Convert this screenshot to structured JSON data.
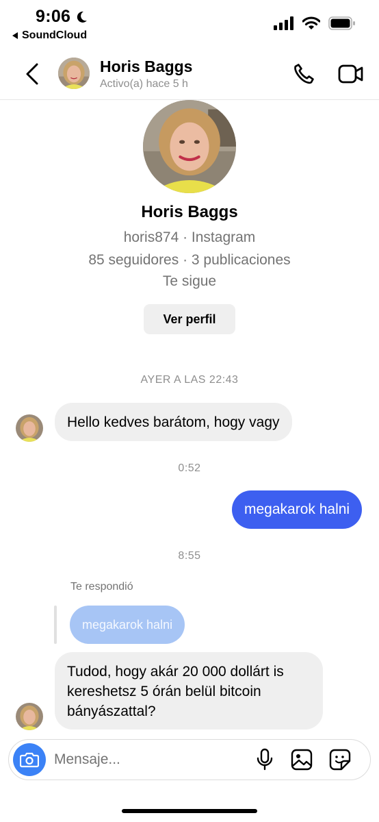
{
  "status_bar": {
    "time": "9:06",
    "back_app": "SoundCloud"
  },
  "header": {
    "name": "Horis Baggs",
    "status": "Activo(a) hace 5 h"
  },
  "profile": {
    "name": "Horis Baggs",
    "handle_line": "horis874 · Instagram",
    "stats_line": "85 seguidores · 3 publicaciones",
    "follow_status": "Te sigue",
    "view_profile_label": "Ver perfil"
  },
  "messages": {
    "timestamp_1": "AYER A LAS 22:43",
    "msg_1": "Hello kedves barátom, hogy vagy",
    "timestamp_2": "0:52",
    "msg_2": "megakarok halni",
    "timestamp_3": "8:55",
    "reply_label": "Te respondió",
    "reply_quote": "megakarok halni",
    "msg_3_lines": [
      "Tudod, hogy akár 20 000 dollárt is",
      "kereshetsz 5 órán belül bitcoin",
      "bányászattal?"
    ]
  },
  "composer": {
    "placeholder": "Mensaje..."
  },
  "colors": {
    "outgoing_bubble": "#3d5ff0",
    "incoming_bubble": "#efefef",
    "camera_button": "#3b82f6",
    "reply_quote": "#a7c5f5"
  },
  "icons": [
    "moon-icon",
    "signal-icon",
    "wifi-icon",
    "battery-icon",
    "back-arrow-icon",
    "phone-icon",
    "video-icon",
    "camera-icon",
    "microphone-icon",
    "image-icon",
    "sticker-icon"
  ]
}
